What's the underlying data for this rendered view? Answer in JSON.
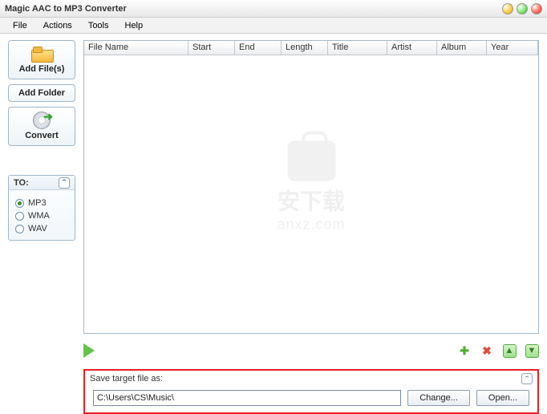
{
  "window": {
    "title": "Magic AAC to MP3 Converter"
  },
  "menu": {
    "file": "File",
    "actions": "Actions",
    "tools": "Tools",
    "help": "Help"
  },
  "sidebar": {
    "addFiles": "Add File(s)",
    "addFolder": "Add Folder",
    "convert": "Convert"
  },
  "toPanel": {
    "title": "TO:",
    "options": [
      {
        "label": "MP3",
        "checked": true
      },
      {
        "label": "WMA",
        "checked": false
      },
      {
        "label": "WAV",
        "checked": false
      }
    ]
  },
  "columns": {
    "fileName": "File Name",
    "start": "Start",
    "end": "End",
    "length": "Length",
    "title": "Title",
    "artist": "Artist",
    "album": "Album",
    "year": "Year"
  },
  "watermark": {
    "zh": "安下载",
    "en": "anxz.com"
  },
  "save": {
    "label": "Save target file as:",
    "path": "C:\\Users\\CS\\Music\\",
    "change": "Change...",
    "open": "Open..."
  }
}
